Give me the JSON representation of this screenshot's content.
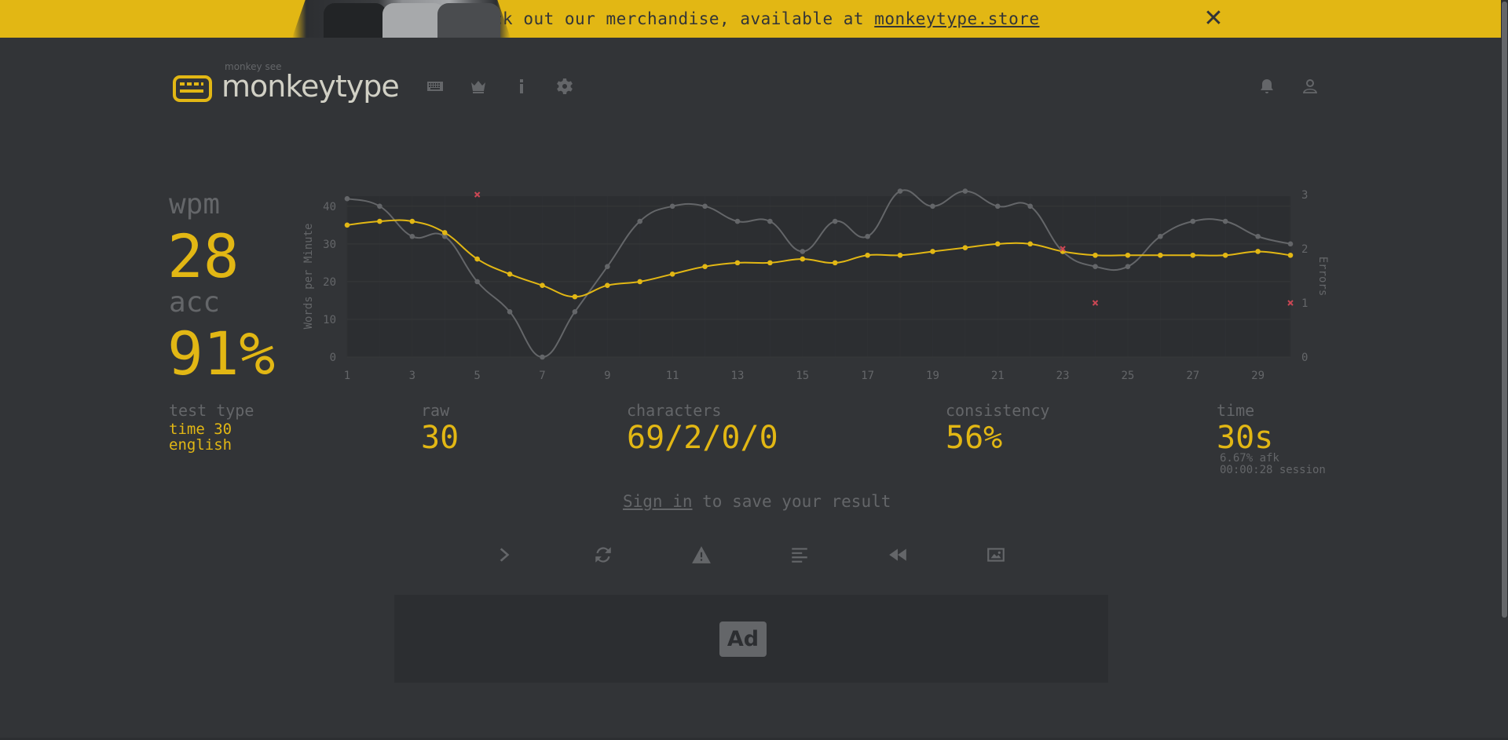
{
  "banner": {
    "text": "Check out our merchandise, available at ",
    "link": "monkeytype.store",
    "close_label": "✕"
  },
  "header": {
    "logo_top": "monkey see",
    "logo_text": "monkeytype",
    "nav": [
      "keyboard-icon",
      "crown-icon",
      "info-icon",
      "gear-icon"
    ],
    "right": [
      "bell-icon",
      "user-icon"
    ]
  },
  "result": {
    "wpm_label": "wpm",
    "wpm_value": "28",
    "acc_label": "acc",
    "acc_value": "91%",
    "test_type_label": "test type",
    "test_type_line1": "time 30",
    "test_type_line2": "english",
    "raw_label": "raw",
    "raw_value": "30",
    "characters_label": "characters",
    "characters_value": "69/2/0/0",
    "consistency_label": "consistency",
    "consistency_value": "56%",
    "time_label": "time",
    "time_value": "30s",
    "afk": "6.67% afk",
    "session": "00:00:28 session"
  },
  "signin": {
    "link": "Sign in",
    "text": " to save your result"
  },
  "actions": [
    "next-test-icon",
    "restart-icon",
    "report-icon",
    "words-history-icon",
    "replay-icon",
    "screenshot-icon"
  ],
  "ad": {
    "label": "Ad"
  },
  "colors": {
    "background": "#323437",
    "accent": "#e2b714",
    "sub": "#646669",
    "text": "#d1d0c5",
    "error": "#ca4754"
  },
  "chart_data": {
    "type": "line",
    "x": [
      1,
      2,
      3,
      4,
      5,
      6,
      7,
      8,
      9,
      10,
      11,
      12,
      13,
      14,
      15,
      16,
      17,
      18,
      19,
      20,
      21,
      22,
      23,
      24,
      25,
      26,
      27,
      28,
      29,
      30
    ],
    "xticks": [
      "1",
      "3",
      "5",
      "7",
      "9",
      "11",
      "13",
      "15",
      "17",
      "19",
      "21",
      "23",
      "25",
      "27",
      "29"
    ],
    "ylabel": "Words per Minute",
    "y2label": "Errors",
    "ylim": [
      0,
      41
    ],
    "yticks": [
      "0",
      "10",
      "20",
      "30",
      "40"
    ],
    "y2lim": [
      0,
      3
    ],
    "y2ticks": [
      "0",
      "1",
      "2",
      "3"
    ],
    "series": [
      {
        "values": [
          42,
          40,
          32,
          32,
          20,
          12,
          0,
          12,
          24,
          36,
          40,
          40,
          36,
          36,
          28,
          36,
          32,
          44,
          40,
          44,
          40,
          40,
          28,
          24,
          24,
          32,
          36,
          36,
          32,
          30
        ],
        "color": "#646669"
      },
      {
        "values": [
          35,
          36,
          36,
          33,
          26,
          22,
          19,
          16,
          19,
          20,
          22,
          24,
          25,
          25,
          26,
          25,
          27,
          27,
          28,
          29,
          30,
          30,
          28,
          27,
          27,
          27,
          27,
          27,
          28,
          27
        ],
        "color": "#e2b714"
      }
    ],
    "errors": [
      {
        "x": 5,
        "y": 3
      },
      {
        "x": 23,
        "y": 2
      },
      {
        "x": 24,
        "y": 1
      },
      {
        "x": 30,
        "y": 1
      }
    ],
    "grid": true
  }
}
